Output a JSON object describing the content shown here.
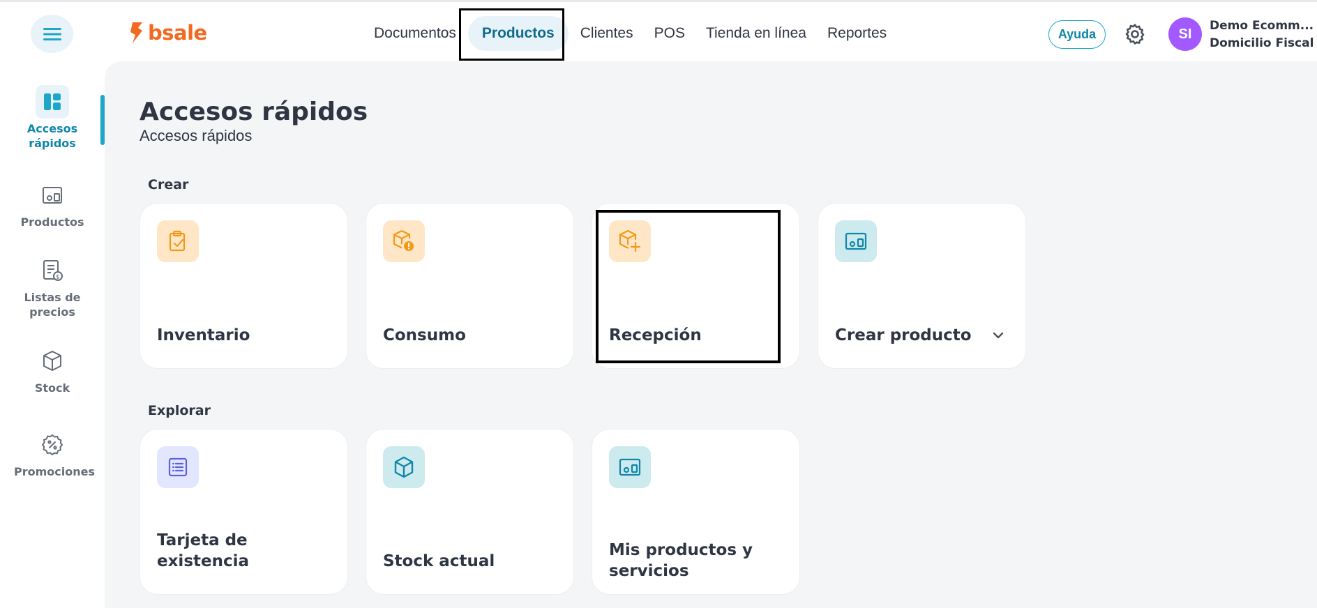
{
  "header": {
    "logo_text": "bsale",
    "nav": [
      {
        "label": "Documentos"
      },
      {
        "label": "Productos"
      },
      {
        "label": "Clientes"
      },
      {
        "label": "POS"
      },
      {
        "label": "Tienda en línea"
      },
      {
        "label": "Reportes"
      }
    ],
    "active_nav": "Productos",
    "help_label": "Ayuda",
    "avatar_initials": "SI",
    "account_name": "Demo Ecomm...",
    "account_subtitle": "Domicilio Fiscal"
  },
  "sidebar": {
    "items": [
      {
        "label": "Accesos rápidos",
        "icon": "dashboard-icon",
        "active": true
      },
      {
        "label": "Productos",
        "icon": "products-icon"
      },
      {
        "label": "Listas de precios",
        "icon": "price-list-icon"
      },
      {
        "label": "Stock",
        "icon": "box-icon"
      },
      {
        "label": "Promociones",
        "icon": "discount-badge-icon"
      }
    ]
  },
  "main": {
    "title": "Accesos rápidos",
    "subtitle": "Accesos rápidos",
    "sections": [
      {
        "label": "Crear",
        "cards": [
          {
            "label": "Inventario",
            "icon": "clipboard-check-icon"
          },
          {
            "label": "Consumo",
            "icon": "box-alert-icon"
          },
          {
            "label": "Recepción",
            "icon": "box-plus-icon"
          },
          {
            "label": "Crear producto",
            "icon": "products-icon",
            "dropdown": true
          }
        ]
      },
      {
        "label": "Explorar",
        "cards": [
          {
            "label": "Tarjeta de existencia",
            "icon": "list-icon"
          },
          {
            "label": "Stock actual",
            "icon": "box-icon"
          },
          {
            "label": "Mis productos y servicios",
            "icon": "products-icon"
          }
        ]
      }
    ]
  },
  "colors": {
    "brand_orange": "#f26a21",
    "accent_teal": "#0f87a8",
    "avatar_purple": "#a259ff",
    "orange_tile": "#ffe6c7",
    "teal_tile": "#cdeaef",
    "purple_tile": "#e3e6ff"
  }
}
